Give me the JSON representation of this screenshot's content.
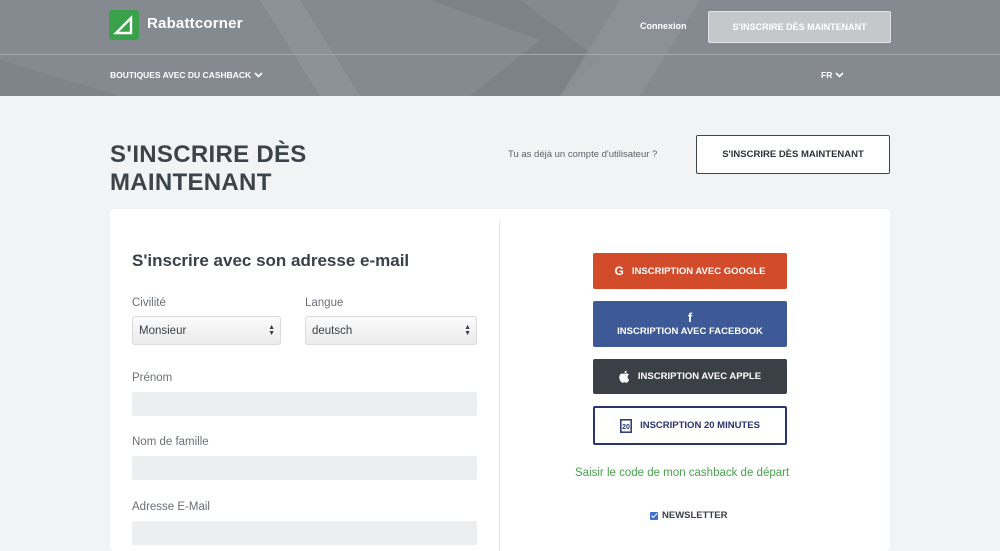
{
  "header": {
    "brand": "Rabattcorner",
    "login_label": "Connexion",
    "cta_label": "S'INSCRIRE DÈS MAINTENANT",
    "shops_menu_label": "BOUTIQUES AVEC DU CASHBACK",
    "language_label": "FR"
  },
  "title_row": {
    "title": "S'INSCRIRE DÈS MAINTENANT",
    "already_account_text": "Tu as déjà un compte d'utilisateur ?",
    "cta_label": "S'INSCRIRE DÈS MAINTENANT"
  },
  "form": {
    "title": "S'inscrire avec son adresse e-mail",
    "civility": {
      "label": "Civilité",
      "value": "Monsieur"
    },
    "language": {
      "label": "Langue",
      "value": "deutsch"
    },
    "first_name": {
      "label": "Prénom",
      "value": ""
    },
    "last_name": {
      "label": "Nom de famille",
      "value": ""
    },
    "email": {
      "label": "Adresse E-Mail",
      "value": ""
    }
  },
  "social": {
    "google_label": "INSCRIPTION AVEC GOOGLE",
    "facebook_label": "INSCRIPTION AVEC FACEBOOK",
    "apple_label": "INSCRIPTION AVEC APPLE",
    "twenty_min_label": "INSCRIPTION 20 MINUTES",
    "twenty_min_icon_text": "20",
    "cashback_code_link": "Saisir le code de mon cashback de départ",
    "newsletter_label": "NEWSLETTER",
    "newsletter_checked": true
  },
  "colors": {
    "brand_green": "#3aa14a",
    "google_red": "#d24b2b",
    "facebook_blue": "#3d5a97",
    "apple_dark": "#3b4047",
    "twenty_min_navy": "#2a3470",
    "link_green": "#4aa34f",
    "header_gray": "#858a90"
  },
  "icons": {
    "logo": "rabattcorner-logo-icon",
    "google": "google-icon",
    "facebook": "facebook-icon",
    "apple": "apple-icon",
    "twenty_min": "20-minutes-icon",
    "chevron": "chevron-down-icon"
  }
}
